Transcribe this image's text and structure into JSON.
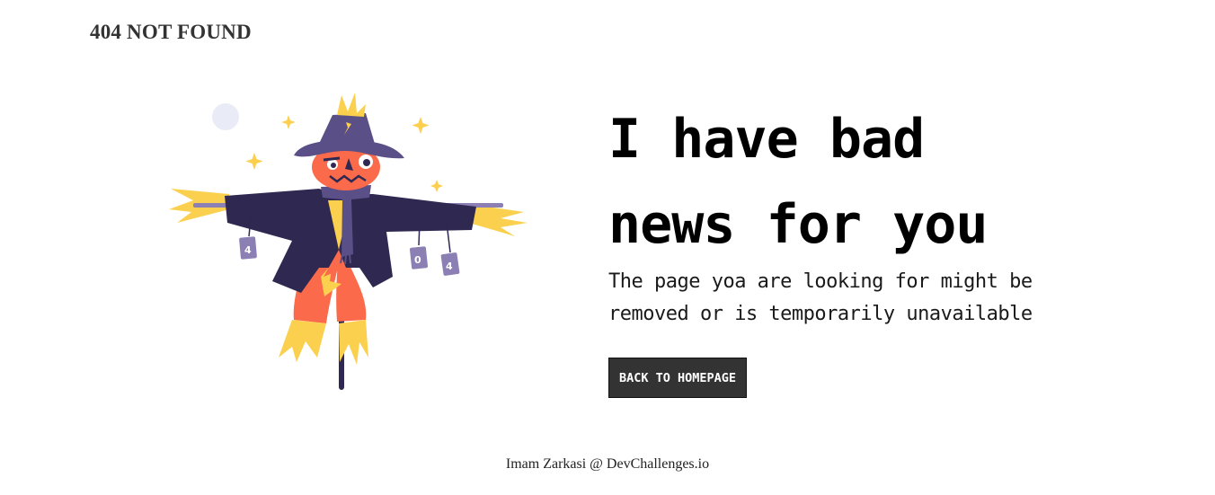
{
  "header": {
    "brand": "404 NOT FOUND"
  },
  "illustration": {
    "subject": "scarecrow",
    "cans": [
      "4",
      "0",
      "4"
    ]
  },
  "main": {
    "headline": "I have bad news for you",
    "message": "The page yoa are looking for might be removed or is temporarily unavailable",
    "cta_label": "BACK TO HOMEPAGE"
  },
  "footer": {
    "credit": "Imam Zarkasi @ DevChallenges.io"
  },
  "colors": {
    "hat": "#5a4f86",
    "coat": "#2f2851",
    "skin": "#fb6a4b",
    "straw": "#fbd04e",
    "can": "#8b7fb3",
    "moon": "#e9ecf6",
    "button_bg": "#333333"
  }
}
